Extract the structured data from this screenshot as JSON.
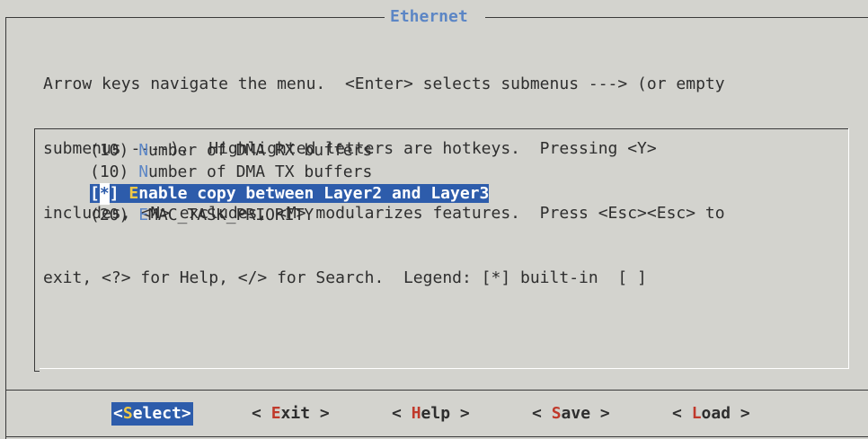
{
  "dialog": {
    "title": "Ethernet"
  },
  "help": {
    "lines": [
      "Arrow keys navigate the menu.  <Enter> selects submenus ---> (or empty",
      "submenus ----).  Highlighted letters are hotkeys.  Pressing <Y>",
      "includes, <N> excludes, <M> modularizes features.  Press <Esc><Esc> to",
      "exit, <?> for Help, </> for Search.  Legend: [*] built-in  [ ]"
    ]
  },
  "menu": {
    "items": [
      {
        "prefix": "(10) ",
        "hotkey": "N",
        "rest": "umber of DMA RX buffers"
      },
      {
        "prefix": "(10) ",
        "hotkey": "N",
        "rest": "umber of DMA TX buffers"
      },
      {
        "prefix_open": "[",
        "prefix_mark": "*",
        "prefix_close": "] ",
        "hotkey": "E",
        "rest": "nable copy between Layer2 and Layer3",
        "selected": true
      },
      {
        "prefix": "(20) ",
        "hotkey": "E",
        "rest": "MAC_TASK_PRIORITY"
      }
    ]
  },
  "buttons": {
    "select": {
      "open": "<",
      "hotkey": "S",
      "rest": "elect>"
    },
    "exit": {
      "open": "< ",
      "hotkey": "E",
      "rest": "xit >"
    },
    "help": {
      "open": "< ",
      "hotkey": "H",
      "rest": "elp >"
    },
    "save": {
      "open": "< ",
      "hotkey": "S",
      "rest": "ave >"
    },
    "load": {
      "open": "< ",
      "hotkey": "L",
      "rest": "oad >"
    }
  },
  "colors": {
    "background": "#d3d3ce",
    "title": "#5c86c5",
    "selection": "#2d5cab",
    "hotkey_button": "#c0392b",
    "hotkey_selected": "#f0c846"
  }
}
